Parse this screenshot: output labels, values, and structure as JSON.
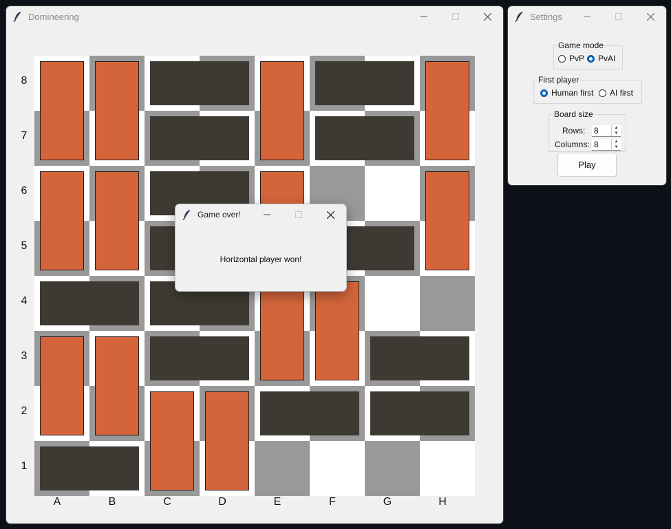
{
  "main_window": {
    "title": "Domineering",
    "row_labels": [
      "8",
      "7",
      "6",
      "5",
      "4",
      "3",
      "2",
      "1"
    ],
    "column_labels": [
      "A",
      "B",
      "C",
      "D",
      "E",
      "F",
      "G",
      "H"
    ]
  },
  "settings": {
    "title": "Settings",
    "game_mode": {
      "legend": "Game mode",
      "options": [
        {
          "label": "PvP",
          "selected": false
        },
        {
          "label": "PvAI",
          "selected": true
        }
      ]
    },
    "first_player": {
      "legend": "First player",
      "options": [
        {
          "label": "Human first",
          "selected": true
        },
        {
          "label": "AI first",
          "selected": false
        }
      ]
    },
    "board_size": {
      "legend": "Board size",
      "rows_label": "Rows:",
      "rows_value": "8",
      "columns_label": "Columns:",
      "columns_value": "8"
    },
    "play_label": "Play"
  },
  "dialog": {
    "title": "Game over!",
    "message": "Horizontal player won!"
  },
  "colors": {
    "vertical_piece": "#d4653b",
    "horizontal_piece": "#3e3a33",
    "light_square": "#ffffff",
    "dark_square": "#999999",
    "accent": "#0a5fb4"
  },
  "board": {
    "rows": 8,
    "columns": 8,
    "horizontal_dominoes": [
      {
        "cells": [
          "C8",
          "D8"
        ]
      },
      {
        "cells": [
          "F8",
          "G8"
        ]
      },
      {
        "cells": [
          "C7",
          "D7"
        ]
      },
      {
        "cells": [
          "F7",
          "G7"
        ]
      },
      {
        "cells": [
          "C6",
          "D6"
        ]
      },
      {
        "cells": [
          "C5",
          "D5"
        ]
      },
      {
        "cells": [
          "F5",
          "G5"
        ]
      },
      {
        "cells": [
          "A4",
          "B4"
        ]
      },
      {
        "cells": [
          "C4",
          "D4"
        ]
      },
      {
        "cells": [
          "C3",
          "D3"
        ]
      },
      {
        "cells": [
          "G3",
          "H3"
        ]
      },
      {
        "cells": [
          "E2",
          "F2"
        ]
      },
      {
        "cells": [
          "G2",
          "H2"
        ]
      },
      {
        "cells": [
          "A1",
          "B1"
        ]
      }
    ],
    "vertical_dominoes": [
      {
        "cells": [
          "A8",
          "A7"
        ]
      },
      {
        "cells": [
          "B8",
          "B7"
        ]
      },
      {
        "cells": [
          "E8",
          "E7"
        ]
      },
      {
        "cells": [
          "H8",
          "H7"
        ]
      },
      {
        "cells": [
          "A6",
          "A5"
        ]
      },
      {
        "cells": [
          "B6",
          "B5"
        ]
      },
      {
        "cells": [
          "E6",
          "E5"
        ]
      },
      {
        "cells": [
          "H6",
          "H5"
        ]
      },
      {
        "cells": [
          "E4",
          "E3"
        ]
      },
      {
        "cells": [
          "F4",
          "F3"
        ]
      },
      {
        "cells": [
          "A3",
          "A2"
        ]
      },
      {
        "cells": [
          "B3",
          "B2"
        ]
      },
      {
        "cells": [
          "C2",
          "C1"
        ]
      },
      {
        "cells": [
          "D2",
          "D1"
        ]
      }
    ]
  }
}
